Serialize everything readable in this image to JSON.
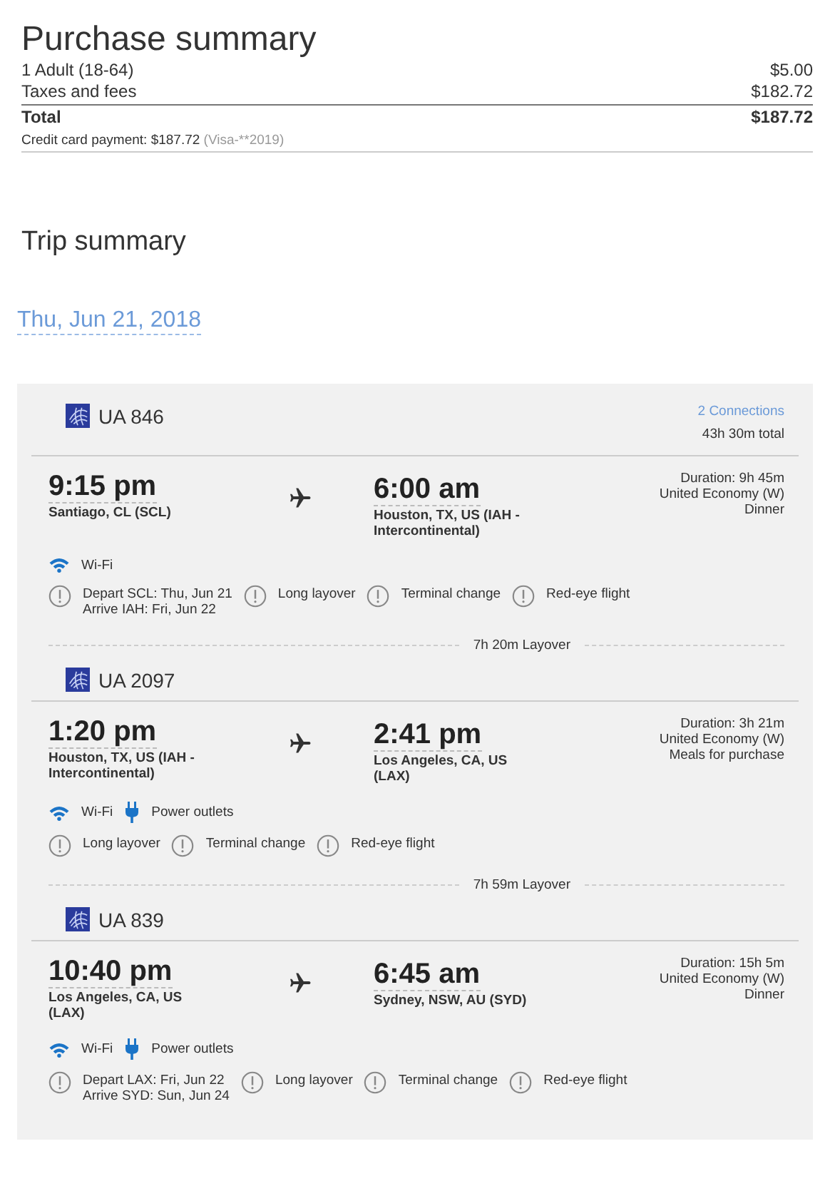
{
  "purchase": {
    "title": "Purchase summary",
    "lines": [
      {
        "label": "1 Adult (18-64)",
        "amount": "$5.00"
      },
      {
        "label": "Taxes and fees",
        "amount": "$182.72"
      }
    ],
    "total": {
      "label": "Total",
      "amount": "$187.72"
    },
    "payment": {
      "text": "Credit card payment: $187.72",
      "card": "(Visa-**2019)"
    }
  },
  "trip": {
    "title": "Trip summary",
    "date": "Thu, Jun 21, 2018",
    "connections": "2 Connections",
    "total_time": "43h 30m total",
    "segments": [
      {
        "flight": "UA 846",
        "depart_time": "9:15 pm",
        "depart_city": "Santiago, CL (SCL)",
        "arrive_time": "6:00 am",
        "arrive_city": "Houston, TX, US (IAH - Intercontinental)",
        "details": [
          "Duration: 9h 45m",
          "United Economy (W)",
          "Dinner"
        ],
        "amenities": [
          {
            "kind": "wifi",
            "label": "Wi-Fi"
          }
        ],
        "warnings": [
          {
            "lines": [
              "Depart SCL: Thu, Jun 21",
              "Arrive IAH: Fri, Jun 22"
            ]
          },
          {
            "lines": [
              "Long layover"
            ]
          },
          {
            "lines": [
              "Terminal change"
            ]
          },
          {
            "lines": [
              "Red-eye flight"
            ]
          }
        ],
        "layover": "7h 20m Layover"
      },
      {
        "flight": "UA 2097",
        "depart_time": "1:20 pm",
        "depart_city": "Houston, TX, US (IAH - Intercontinental)",
        "arrive_time": "2:41 pm",
        "arrive_city": "Los Angeles, CA, US (LAX)",
        "details": [
          "Duration: 3h 21m",
          "United Economy (W)",
          "Meals for purchase"
        ],
        "amenities": [
          {
            "kind": "wifi",
            "label": "Wi-Fi"
          },
          {
            "kind": "power",
            "label": "Power outlets"
          }
        ],
        "warnings": [
          {
            "lines": [
              "Long layover"
            ]
          },
          {
            "lines": [
              "Terminal change"
            ]
          },
          {
            "lines": [
              "Red-eye flight"
            ]
          }
        ],
        "layover": "7h 59m Layover"
      },
      {
        "flight": "UA 839",
        "depart_time": "10:40 pm",
        "depart_city": "Los Angeles, CA, US (LAX)",
        "arrive_time": "6:45 am",
        "arrive_city": "Sydney, NSW, AU (SYD)",
        "details": [
          "Duration: 15h 5m",
          "United Economy (W)",
          "Dinner"
        ],
        "amenities": [
          {
            "kind": "wifi",
            "label": "Wi-Fi"
          },
          {
            "kind": "power",
            "label": "Power outlets"
          }
        ],
        "warnings": [
          {
            "lines": [
              "Depart LAX: Fri, Jun 22",
              "Arrive SYD: Sun, Jun 24"
            ]
          },
          {
            "lines": [
              "Long layover"
            ]
          },
          {
            "lines": [
              "Terminal change"
            ]
          },
          {
            "lines": [
              "Red-eye flight"
            ]
          }
        ]
      }
    ]
  }
}
